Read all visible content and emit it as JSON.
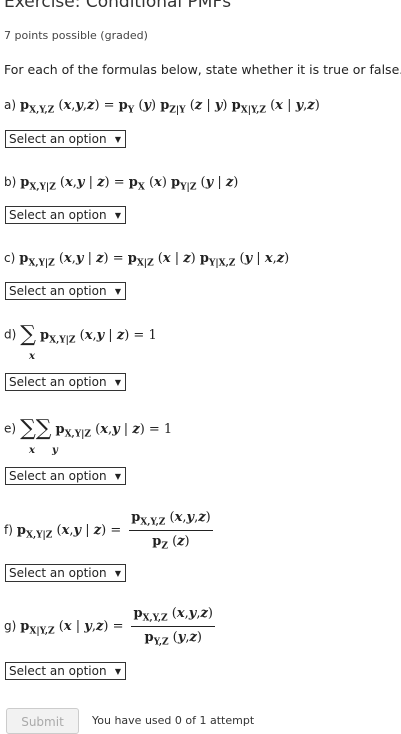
{
  "exercise": {
    "title": "Exercise: Conditional PMFs",
    "points": "7 points possible (graded)",
    "instructions": "For each of the formulas below, state whether it is true or false."
  },
  "questions": [
    {
      "label": "a)",
      "formula": "pX,Y,Z(x,y,z) = pY(y) pZ|Y(z | y) pX|Y,Z(x | y,z)",
      "selected": "Select an option"
    },
    {
      "label": "b)",
      "formula": "pX,Y|Z(x,y | z) = pX(x) pY|Z(y | z)",
      "selected": "Select an option"
    },
    {
      "label": "c)",
      "formula": "pX,Y|Z(x,y | z) = pX|Z(x | z) pY|X,Z(y | x,z)",
      "selected": "Select an option"
    },
    {
      "label": "d)",
      "formula": "Σx pX,Y|Z(x,y | z) = 1",
      "selected": "Select an option"
    },
    {
      "label": "e)",
      "formula": "Σx Σy pX,Y|Z(x,y | z) = 1",
      "selected": "Select an option"
    },
    {
      "label": "f)",
      "formula": "pX,Y|Z(x,y | z) = pX,Y,Z(x,y,z) / pZ(z)",
      "selected": "Select an option"
    },
    {
      "label": "g)",
      "formula": "pX|Y,Z(x | y,z) = pX,Y,Z(x,y,z) / pY,Z(y,z)",
      "selected": "Select an option"
    }
  ],
  "select_arrow_icon": "triangle-down",
  "footer": {
    "submit_label": "Submit",
    "attempts_text": "You have used 0 of 1 attempt"
  }
}
